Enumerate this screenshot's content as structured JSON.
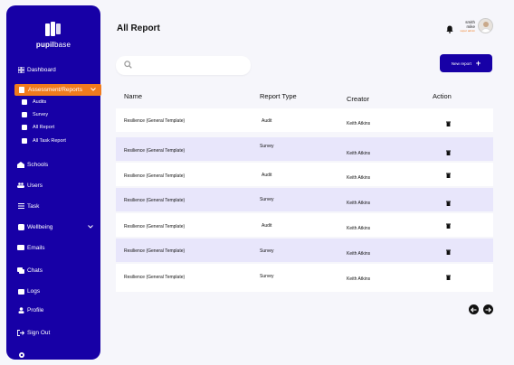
{
  "brand": {
    "logo_text_bold": "pupil",
    "logo_text_thin": "base"
  },
  "sidebar": {
    "items": [
      {
        "label": "Dashboard",
        "icon": "grid-icon"
      },
      {
        "label": "Assessment/Reports",
        "icon": "report-icon",
        "active": true
      },
      {
        "label": "Schools",
        "icon": "school-icon"
      },
      {
        "label": "Users",
        "icon": "users-icon"
      },
      {
        "label": "Task",
        "icon": "list-icon"
      },
      {
        "label": "Wellbeing",
        "icon": "wellbeing-icon"
      },
      {
        "label": "Emails",
        "icon": "email-icon"
      },
      {
        "label": "Chats",
        "icon": "chat-icon"
      },
      {
        "label": "Logs",
        "icon": "logs-icon"
      },
      {
        "label": "Profile",
        "icon": "profile-icon"
      },
      {
        "label": "Sign Out",
        "icon": "sign-out-icon"
      }
    ],
    "sub_items": [
      {
        "label": "Audits"
      },
      {
        "label": "Survey"
      },
      {
        "label": "All Report"
      },
      {
        "label": "All Task Report"
      }
    ]
  },
  "header": {
    "title": "All Report",
    "user_name_line1": "smith",
    "user_name_line2": "mike",
    "user_role": "super admin"
  },
  "toolbar": {
    "search_placeholder": "",
    "new_button_label": "New report"
  },
  "table": {
    "columns": [
      "Name",
      "Report Type",
      "Creator",
      "Action"
    ],
    "rows": [
      {
        "name": "Resilience (General Template)",
        "type": "Audit",
        "creator": "Keith Atkins"
      },
      {
        "name": "Resilience (General Template)",
        "type": "Survey",
        "creator": "Keith Atkins"
      },
      {
        "name": "Resilience (General Template)",
        "type": "Audit",
        "creator": "Keith Atkins"
      },
      {
        "name": "Resilience (General Template)",
        "type": "Survey",
        "creator": "Keith Atkins"
      },
      {
        "name": "Resilience (General Template)",
        "type": "Audit",
        "creator": "Keith Atkins"
      },
      {
        "name": "Resilience (General Template)",
        "type": "Survey",
        "creator": "Keith Atkins"
      },
      {
        "name": "Resilience (General Template)",
        "type": "Survey",
        "creator": "Keith Atkins"
      }
    ]
  },
  "colors": {
    "primary": "#1700a6",
    "accent": "#f07b1d",
    "row_alt": "#e8e6fb"
  }
}
